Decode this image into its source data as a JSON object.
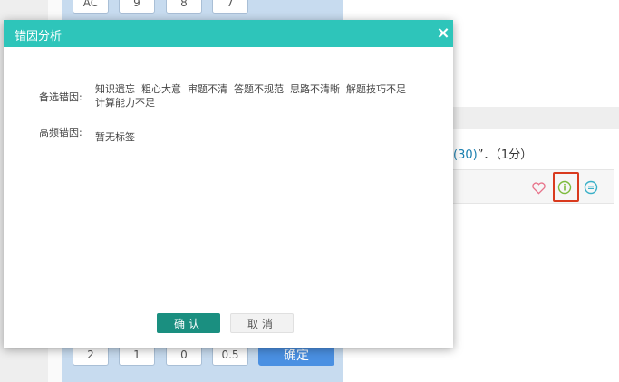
{
  "background": {
    "keypad_top_keys": [
      "AC",
      "9",
      "8",
      "7"
    ],
    "keypad_bottom_keys": [
      "2",
      "1",
      "0",
      "0.5"
    ],
    "keypad_confirm_label": "确定",
    "question_text_link": "(30)",
    "question_text_tail": "”．（1分）"
  },
  "modal": {
    "title": "错因分析",
    "close_label": "×",
    "candidate_label": "备选错因:",
    "candidate_tags": [
      "知识遗忘",
      "粗心大意",
      "审题不清",
      "答题不规范",
      "思路不清晰",
      "解题技巧不足",
      "计算能力不足"
    ],
    "frequent_label": "高频错因:",
    "frequent_value": "暂无标签",
    "confirm_label": "确认",
    "cancel_label": "取消"
  },
  "colors": {
    "header": "#2ec5ba",
    "confirm": "#1a8f80",
    "highlight_border": "#d93a1e",
    "keypad_bg": "#c7dbef"
  }
}
